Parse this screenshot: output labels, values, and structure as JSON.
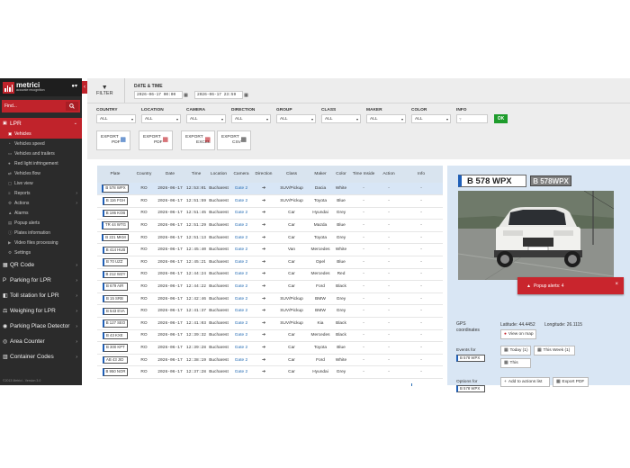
{
  "brand": {
    "name": "metrici",
    "tagline": "accurate recognition"
  },
  "sidebar": {
    "search_placeholder": "Find...",
    "lpr_label": "LPR",
    "lpr_subitems": [
      {
        "label": "Vehicles",
        "icon": "car-icon",
        "active": true
      },
      {
        "label": "Vehicles speed",
        "icon": "speed-icon"
      },
      {
        "label": "Vehicles and trailers",
        "icon": "trailer-icon"
      },
      {
        "label": "Red light infringement",
        "icon": "traffic-light-icon"
      },
      {
        "label": "Vehicles flow",
        "icon": "flow-icon"
      },
      {
        "label": "Live view",
        "icon": "monitor-icon"
      },
      {
        "label": "Reports",
        "icon": "report-icon"
      },
      {
        "label": "Actions",
        "icon": "gear-icon"
      },
      {
        "label": "Alarms",
        "icon": "bell-icon"
      },
      {
        "label": "Popup alerts",
        "icon": "popup-icon"
      },
      {
        "label": "Plates information",
        "icon": "info-icon"
      },
      {
        "label": "Video files processing",
        "icon": "video-icon"
      },
      {
        "label": "Settings",
        "icon": "settings-icon"
      }
    ],
    "main_items": [
      {
        "label": "QR Code",
        "icon": "qr-icon"
      },
      {
        "label": "Parking for LPR",
        "icon": "parking-icon"
      },
      {
        "label": "Toll station for LPR",
        "icon": "toll-icon"
      },
      {
        "label": "Weighing for LPR",
        "icon": "scale-icon"
      },
      {
        "label": "Parking Place Detector",
        "icon": "parking-detector-icon"
      },
      {
        "label": "Area Counter",
        "icon": "counter-icon"
      },
      {
        "label": "Container Codes",
        "icon": "container-icon"
      }
    ],
    "version": "©2013 Metrici - Version 3.0"
  },
  "filters": {
    "filter_label": "FILTER",
    "datetime_label": "DATE & TIME",
    "date_from": "2026-06-17 00:00",
    "date_to": "2026-06-17 23:59",
    "fields": [
      {
        "label": "COUNTRY",
        "value": "ALL"
      },
      {
        "label": "LOCATION",
        "value": "ALL"
      },
      {
        "label": "CAMERA",
        "value": "ALL"
      },
      {
        "label": "DIRECTION",
        "value": "ALL"
      },
      {
        "label": "GROUP",
        "value": "ALL"
      },
      {
        "label": "CLASS",
        "value": "ALL"
      },
      {
        "label": "MAKER",
        "value": "ALL"
      },
      {
        "label": "COLOR",
        "value": "ALL"
      }
    ],
    "info_label": "INFO",
    "info_placeholder": "?",
    "ok_label": "OK",
    "exports": [
      {
        "line1": "EXPORT",
        "line2": "PDF",
        "icon": "pdf-blue-icon"
      },
      {
        "line1": "EXPORT",
        "line2": "PDF",
        "icon": "pdf-red-icon"
      },
      {
        "line1": "EXPORT",
        "line2": "EXCEL",
        "icon": "excel-icon"
      },
      {
        "line1": "EXPORT",
        "line2": "CSV",
        "icon": "csv-icon"
      }
    ]
  },
  "table": {
    "columns": [
      "Plate",
      "Country",
      "Date",
      "Time",
      "Location",
      "Camera",
      "Direction",
      "Class",
      "Maker",
      "Color",
      "Time Inside",
      "Action",
      "Info"
    ],
    "rows": [
      {
        "plate": "B 578 WPX",
        "country": "RO",
        "date": "2026-06-17",
        "time": "12:53:01",
        "location": "Bucharest",
        "camera": "Gate 2",
        "direction": "➔",
        "class": "SUV/Pickup",
        "maker": "Dacia",
        "color": "White",
        "inside": "-",
        "action": "-",
        "info": "-"
      },
      {
        "plate": "B 116 FGH",
        "country": "RO",
        "date": "2026-06-17",
        "time": "12:51:59",
        "location": "Bucharest",
        "camera": "Gate 2",
        "direction": "➔",
        "class": "SUV/Pickup",
        "maker": "Toyota",
        "color": "Blue",
        "inside": "-",
        "action": "-",
        "info": "-"
      },
      {
        "plate": "B 186 KOB",
        "country": "RO",
        "date": "2026-06-17",
        "time": "12:51:45",
        "location": "Bucharest",
        "camera": "Gate 2",
        "direction": "➔",
        "class": "Car",
        "maker": "Hyundai",
        "color": "Grey",
        "inside": "-",
        "action": "-",
        "info": "-"
      },
      {
        "plate": "TR 44 WTG",
        "country": "RO",
        "date": "2026-06-17",
        "time": "12:51:29",
        "location": "Bucharest",
        "camera": "Gate 2",
        "direction": "➔",
        "class": "Car",
        "maker": "Mazda",
        "color": "Blue",
        "inside": "-",
        "action": "-",
        "info": "-"
      },
      {
        "plate": "B 221 MKM",
        "country": "RO",
        "date": "2026-06-17",
        "time": "12:51:13",
        "location": "Bucharest",
        "camera": "Gate 2",
        "direction": "➔",
        "class": "Car",
        "maker": "Toyota",
        "color": "Grey",
        "inside": "-",
        "action": "-",
        "info": "-"
      },
      {
        "plate": "B 414 HUB",
        "country": "RO",
        "date": "2026-06-17",
        "time": "12:45:40",
        "location": "Bucharest",
        "camera": "Gate 2",
        "direction": "➔",
        "class": "Van",
        "maker": "Mercedes",
        "color": "White",
        "inside": "-",
        "action": "-",
        "info": "-"
      },
      {
        "plate": "B 70 UZZ",
        "country": "RO",
        "date": "2026-06-17",
        "time": "12:45:21",
        "location": "Bucharest",
        "camera": "Gate 2",
        "direction": "➔",
        "class": "Car",
        "maker": "Opel",
        "color": "Blue",
        "inside": "-",
        "action": "-",
        "info": "-"
      },
      {
        "plate": "B 212 WZY",
        "country": "RO",
        "date": "2026-06-17",
        "time": "12:44:24",
        "location": "Bucharest",
        "camera": "Gate 2",
        "direction": "➔",
        "class": "Car",
        "maker": "Mercedes",
        "color": "Red",
        "inside": "-",
        "action": "-",
        "info": "-"
      },
      {
        "plate": "B 679 AIR",
        "country": "RO",
        "date": "2026-06-17",
        "time": "12:44:22",
        "location": "Bucharest",
        "camera": "Gate 2",
        "direction": "➔",
        "class": "Car",
        "maker": "Ford",
        "color": "Black",
        "inside": "-",
        "action": "-",
        "info": "-"
      },
      {
        "plate": "B 15 SRB",
        "country": "RO",
        "date": "2026-06-17",
        "time": "12:42:46",
        "location": "Bucharest",
        "camera": "Gate 2",
        "direction": "➔",
        "class": "SUV/Pickup",
        "maker": "BMW",
        "color": "Grey",
        "inside": "-",
        "action": "-",
        "info": "-"
      },
      {
        "plate": "B 543 EVA",
        "country": "RO",
        "date": "2026-06-17",
        "time": "12:41:37",
        "location": "Bucharest",
        "camera": "Gate 2",
        "direction": "➔",
        "class": "SUV/Pickup",
        "maker": "BMW",
        "color": "Grey",
        "inside": "-",
        "action": "-",
        "info": "-"
      },
      {
        "plate": "B 127 SEO",
        "country": "RO",
        "date": "2026-06-17",
        "time": "12:41:03",
        "location": "Bucharest",
        "camera": "Gate 2",
        "direction": "➔",
        "class": "SUV/Pickup",
        "maker": "Kia",
        "color": "Black",
        "inside": "-",
        "action": "-",
        "info": "-"
      },
      {
        "plate": "B 43 KXE",
        "country": "RO",
        "date": "2026-06-17",
        "time": "12:39:32",
        "location": "Bucharest",
        "camera": "Gate 2",
        "direction": "➔",
        "class": "Car",
        "maker": "Mercedes",
        "color": "Black",
        "inside": "-",
        "action": "-",
        "info": "-"
      },
      {
        "plate": "B 300 KPT",
        "country": "RO",
        "date": "2026-06-17",
        "time": "12:39:28",
        "location": "Bucharest",
        "camera": "Gate 2",
        "direction": "➔",
        "class": "Car",
        "maker": "Toyota",
        "color": "Blue",
        "inside": "-",
        "action": "-",
        "info": "-"
      },
      {
        "plate": "AB 43 JID",
        "country": "RO",
        "date": "2026-06-17",
        "time": "12:38:19",
        "location": "Bucharest",
        "camera": "Gate 2",
        "direction": "➔",
        "class": "Car",
        "maker": "Ford",
        "color": "White",
        "inside": "-",
        "action": "-",
        "info": "-"
      },
      {
        "plate": "B 950 NOR",
        "country": "RO",
        "date": "2026-06-17",
        "time": "12:37:28",
        "location": "Bucharest",
        "camera": "Gate 2",
        "direction": "➔",
        "class": "Car",
        "maker": "Hyundai",
        "color": "Grey",
        "inside": "-",
        "action": "-",
        "info": "-"
      }
    ]
  },
  "detail": {
    "plate": "B 578 WPX",
    "crop_plate": "B 578WPX",
    "gps_label_1": "GPS",
    "gps_label_2": "coordinates",
    "latitude": "Latitude: 44.4452",
    "longitude": "Longitude: 26.1115",
    "view_map": "View on map",
    "events_label": "Events for",
    "today": "Today (1)",
    "this_week": "This Week (1)",
    "this_label": "This",
    "options_label": "Options for",
    "add_actions": "Add to actions list",
    "export_pdf": "Export PDF"
  },
  "popup": {
    "text": "Popup alerts: 4",
    "close": "×"
  }
}
